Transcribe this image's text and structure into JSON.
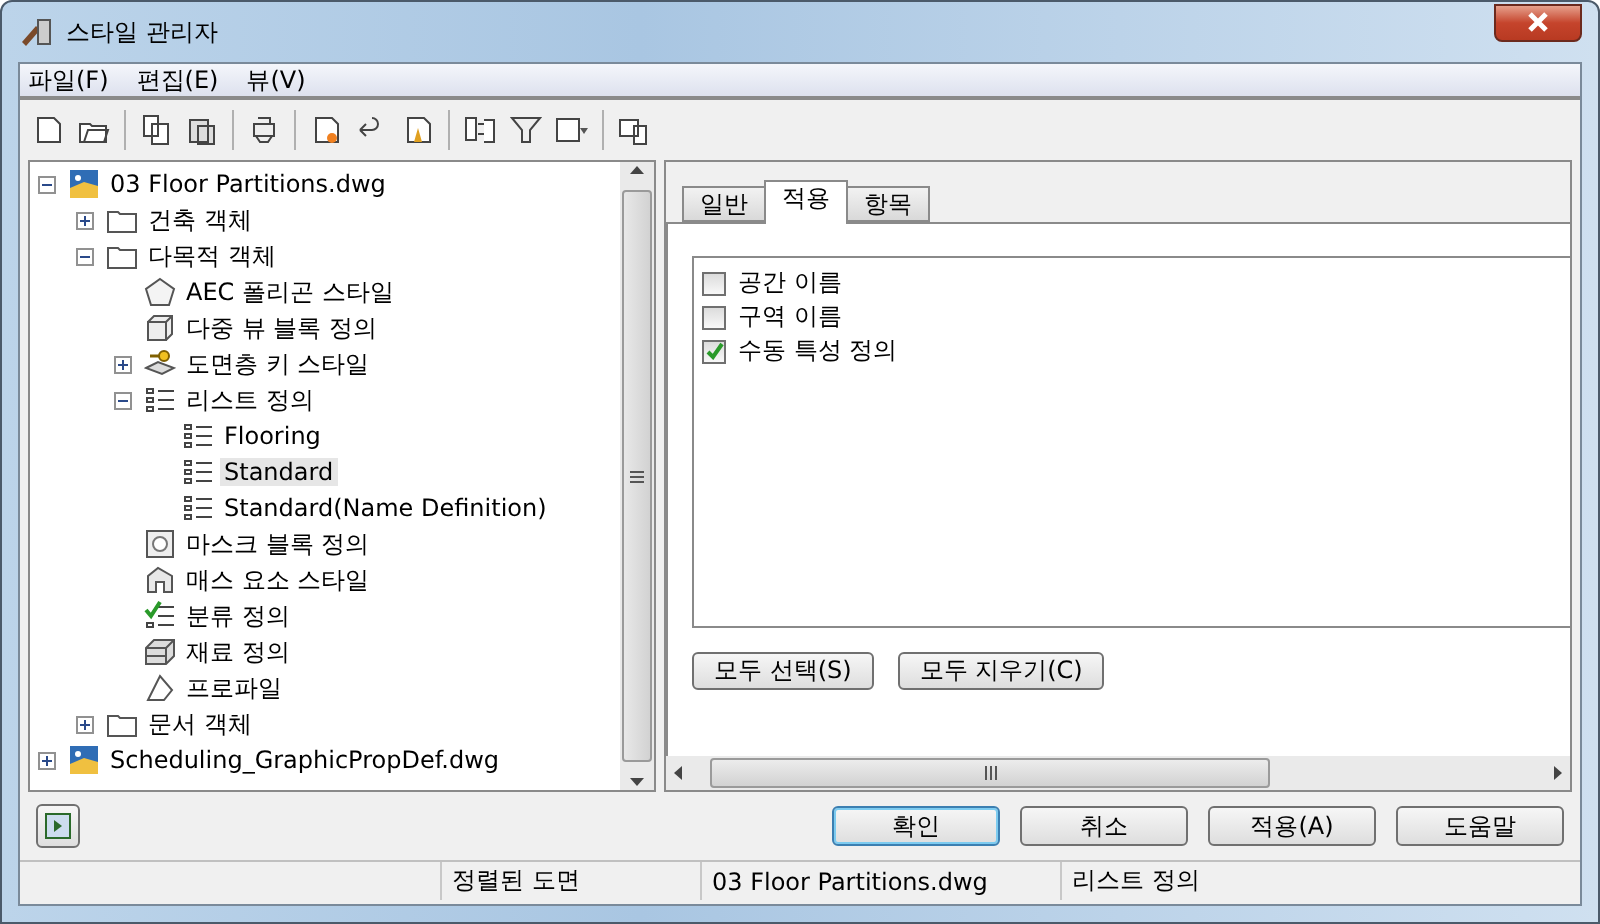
{
  "window": {
    "title": "스타일 관리자"
  },
  "menu": [
    "파일(F)",
    "편집(E)",
    "뷰(V)"
  ],
  "tree": [
    {
      "label": "03 Floor Partitions.dwg",
      "kind": "drawing",
      "expanded": true,
      "selected": false,
      "children": [
        {
          "label": "건축 객체",
          "kind": "folder",
          "expanded": false,
          "selected": false
        },
        {
          "label": "다목적 객체",
          "kind": "folder",
          "expanded": true,
          "selected": false,
          "children": [
            {
              "label": "AEC 폴리곤 스타일",
              "kind": "polygon",
              "selected": false
            },
            {
              "label": "다중 뷰 블록 정의",
              "kind": "block",
              "selected": false
            },
            {
              "label": "도면층 키 스타일",
              "kind": "key",
              "expanded": false,
              "selected": false
            },
            {
              "label": "리스트 정의",
              "kind": "list",
              "expanded": true,
              "selected": false,
              "children": [
                {
                  "label": "Flooring",
                  "kind": "list",
                  "selected": false
                },
                {
                  "label": "Standard",
                  "kind": "list",
                  "selected": true
                },
                {
                  "label": "Standard(Name Definition)",
                  "kind": "list",
                  "selected": false
                }
              ]
            },
            {
              "label": "마스크 블록 정의",
              "kind": "mask",
              "selected": false
            },
            {
              "label": "매스 요소 스타일",
              "kind": "mass",
              "selected": false
            },
            {
              "label": "분류 정의",
              "kind": "classify",
              "selected": false
            },
            {
              "label": "재료 정의",
              "kind": "material",
              "selected": false
            },
            {
              "label": "프로파일",
              "kind": "profile",
              "selected": false
            }
          ]
        },
        {
          "label": "문서 객체",
          "kind": "folder",
          "expanded": false,
          "selected": false
        }
      ]
    },
    {
      "label": "Scheduling_GraphicPropDef.dwg",
      "kind": "drawing",
      "expanded": false,
      "selected": false
    }
  ],
  "tabs": [
    {
      "label": "일반",
      "selected": false
    },
    {
      "label": "적용",
      "selected": true
    },
    {
      "label": "항목",
      "selected": false
    }
  ],
  "apply_list": [
    {
      "label": "공간 이름",
      "checked": false
    },
    {
      "label": "구역 이름",
      "checked": false
    },
    {
      "label": "수동 특성 정의",
      "checked": true
    }
  ],
  "panel_buttons": [
    "모두 선택(S)",
    "모두 지우기(C)"
  ],
  "dialog_buttons": [
    {
      "label": "확인",
      "default": true
    },
    {
      "label": "취소",
      "default": false
    },
    {
      "label": "적용(A)",
      "default": false
    },
    {
      "label": "도움말",
      "default": false
    }
  ],
  "status_bar": [
    "정렬된 도면",
    "03 Floor Partitions.dwg",
    "리스트 정의"
  ]
}
